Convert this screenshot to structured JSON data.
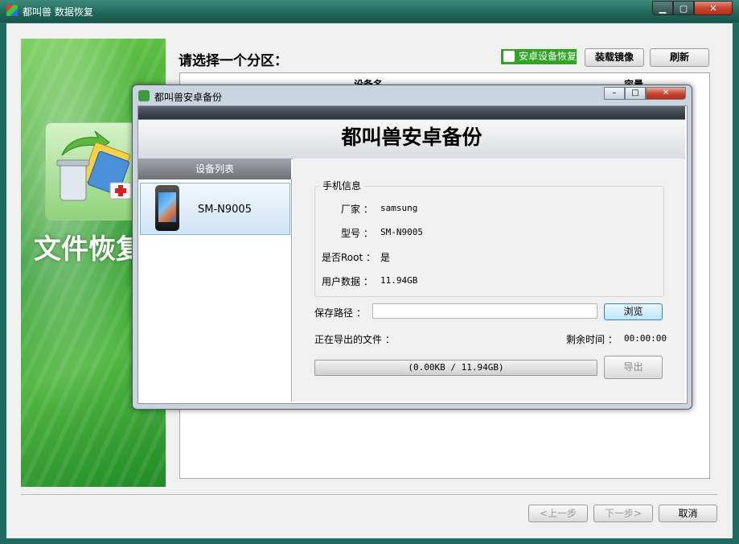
{
  "window": {
    "title": "都叫兽 数据恢复",
    "controls": {
      "min": "▁",
      "max": "▢",
      "close": "✕"
    }
  },
  "banner": {
    "title": "文件恢复"
  },
  "main": {
    "select_partition": "请选择一个分区：",
    "android_recover": "安卓设备恢复",
    "mount_image": "装载镜像",
    "refresh": "刷新",
    "columns": {
      "device": "设备名",
      "capacity": "容量"
    }
  },
  "footer": {
    "prev": "<上一步",
    "next": "下一步>",
    "cancel": "取消"
  },
  "dialog": {
    "title": "都叫兽安卓备份",
    "heading": "都叫兽安卓备份",
    "controls": {
      "min": "–",
      "max": "□",
      "close": "✕"
    },
    "device_list_header": "设备列表",
    "devices": [
      {
        "name": "SM-N9005"
      }
    ],
    "phone_info": {
      "legend": "手机信息",
      "manufacturer_label": "厂家 ：",
      "manufacturer": "samsung",
      "model_label": "型号 ：",
      "model": "SM-N9005",
      "root_label": "是否Root ：",
      "root": "是",
      "user_data_label": "用户数据 ：",
      "user_data": "11.94GB"
    },
    "save_path_label": "保存路径 ：",
    "save_path_value": "",
    "browse": "浏览",
    "exporting_label": "正在导出的文件 ：",
    "remaining_label": "剩余时间 ：",
    "remaining_value": "00:00:00",
    "progress_text": "(0.00KB / 11.94GB)",
    "progress_fraction": 0,
    "export": "导出"
  }
}
